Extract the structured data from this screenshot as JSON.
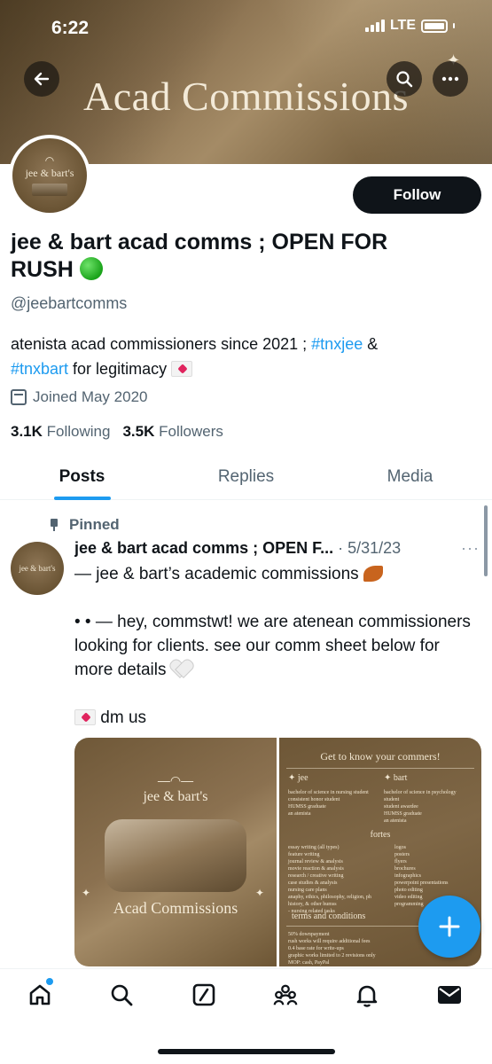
{
  "status_bar": {
    "time": "6:22",
    "network": "LTE"
  },
  "header": {
    "banner_title": "Acad Commissions",
    "back_icon": "arrow-left-icon",
    "search_icon": "search-icon",
    "more_icon": "more-horizontal-icon"
  },
  "profile": {
    "avatar_text": "jee & bart's",
    "follow_label": "Follow",
    "display_name": "jee & bart acad comms ; OPEN FOR RUSH",
    "handle": "@jeebartcomms",
    "bio_prefix": "atenista acad commissioners since 2021 ; ",
    "bio_tag1": "#tnxjee",
    "bio_mid": " & ",
    "bio_tag2": "#tnxbart",
    "bio_suffix": " for legitimacy ",
    "joined": "Joined May 2020",
    "following_count": "3.1K",
    "following_label": "Following",
    "followers_count": "3.5K",
    "followers_label": "Followers"
  },
  "tabs": [
    {
      "label": "Posts",
      "active": true
    },
    {
      "label": "Replies",
      "active": false
    },
    {
      "label": "Media",
      "active": false
    }
  ],
  "post": {
    "pinned_label": "Pinned",
    "author": "jee & bart acad comms ; OPEN F...",
    "date": "· 5/31/23",
    "line1": "— jee & bart’s academic commissions ",
    "line2": "• • — hey, commstwt! we are atenean commissioners looking for clients. see our comm sheet below for more details ",
    "line3": " dm us",
    "media_left": {
      "logo_text": "jee & bart's",
      "subtitle": "Acad Commissions"
    },
    "media_right": {
      "title": "Get to know your commers!",
      "col1_head": "✦ jee",
      "col1_items": [
        "bachelor of science in nursing student",
        "consistent honor student",
        "HUMSS graduate",
        "an atenista"
      ],
      "col2_head": "✦ bart",
      "col2_items": [
        "bachelor of science in psychology student",
        "student awardee",
        "HUMSS graduate",
        "an atenista"
      ],
      "fortes_head": "fortes",
      "fortes1": [
        "essay writing (all types)",
        "feature writing",
        "journal review & analysis",
        "movie reaction & analysis",
        "research / creative writing",
        "case studies & analysis",
        "nursing care plans",
        "anaphy, ethics, philosophy, religion, ph history, & other humss",
        "- nursing related tasks"
      ],
      "fortes2": [
        "logos",
        "posters",
        "flyers",
        "brochures",
        "infographics",
        "powerpoint presentations",
        "photo editing",
        "video editing",
        "programming"
      ],
      "terms_head": "terms and conditions",
      "terms": [
        "50% downpayment",
        "rush works will require additional fees",
        "0.4 base rate for write-ups",
        "graphic works limited to 2 revisions only",
        "MOP: cash, PayPal"
      ]
    }
  },
  "bottom_nav": [
    "home-icon",
    "search-icon",
    "grok-icon",
    "communities-icon",
    "notifications-icon",
    "messages-icon"
  ],
  "colors": {
    "accent": "#1d9bf0",
    "text": "#0f1419",
    "muted": "#536471",
    "banner": "#8a7150"
  }
}
